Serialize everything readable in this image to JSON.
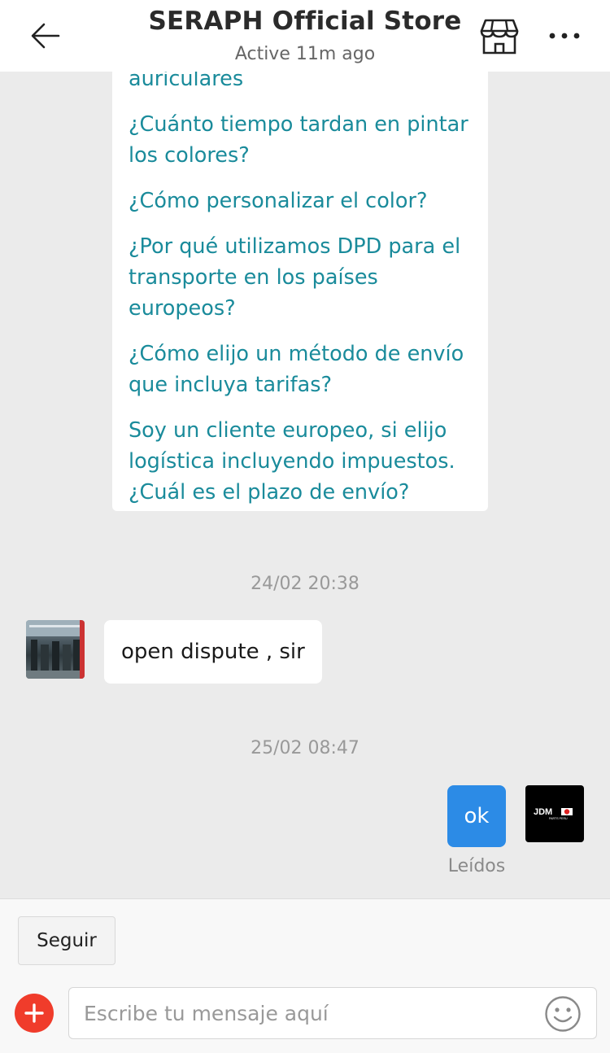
{
  "header": {
    "title": "SERAPH Official Store",
    "status": "Active 11m ago"
  },
  "faq": {
    "partial_text": "auriculares",
    "items": [
      "¿Cuánto tiempo tardan en pintar los colores?",
      "¿Cómo personalizar el color?",
      "¿Por qué utilizamos DPD para el transporte en los países europeos?",
      "¿Cómo elijo un método de envío que incluya tarifas?",
      "Soy un cliente europeo, si elijo logística incluyendo impuestos. ¿Cuál es el plazo de envío?"
    ]
  },
  "messages": {
    "ts1": "24/02 20:38",
    "incoming_text": "open dispute , sir",
    "ts2": "25/02 08:47",
    "outgoing_text": "ok",
    "read_status": "Leídos",
    "avatar_brand": "JDM",
    "avatar_subtext": "PARTS PERU"
  },
  "bottom": {
    "follow_label": "Seguir",
    "input_placeholder": "Escribe tu mensaje aquí"
  },
  "colors": {
    "accent_blue": "#2c8be6",
    "faq_link": "#1a8b9b",
    "plus_red": "#f03c2b"
  }
}
